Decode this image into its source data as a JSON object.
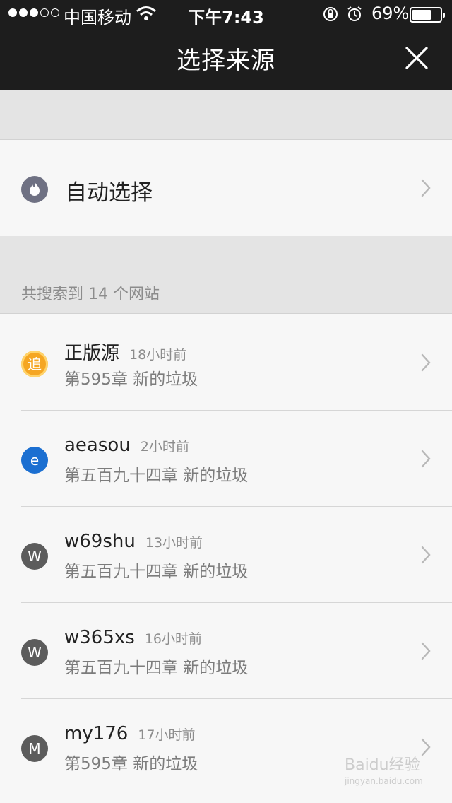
{
  "status_bar": {
    "carrier": "中国移动",
    "time": "下午7:43",
    "battery_percent": "69%",
    "battery_level": 0.69
  },
  "nav": {
    "title": "选择来源",
    "close_icon": "close-icon"
  },
  "auto_select": {
    "label": "自动选择",
    "icon": "flame-icon"
  },
  "result_count": "共搜索到 14 个网站",
  "sources": [
    {
      "name": "正版源",
      "time": "18小时前",
      "chapter": "第595章 新的垃圾",
      "icon_text": "追",
      "icon_color": "#f5a623"
    },
    {
      "name": "aeasou",
      "time": "2小时前",
      "chapter": "第五百九十四章 新的垃圾",
      "icon_text": "e",
      "icon_color": "#1b6fd1"
    },
    {
      "name": "w69shu",
      "time": "13小时前",
      "chapter": "第五百九十四章 新的垃圾",
      "icon_text": "W",
      "icon_color": "#5c5c5c"
    },
    {
      "name": "w365xs",
      "time": "16小时前",
      "chapter": "第五百九十四章 新的垃圾",
      "icon_text": "W",
      "icon_color": "#5c5c5c"
    },
    {
      "name": "my176",
      "time": "17小时前",
      "chapter": "第595章 新的垃圾",
      "icon_text": "M",
      "icon_color": "#5c5c5c"
    }
  ],
  "watermark": {
    "text": "Baidu经验",
    "sub": "jingyan.baidu.com"
  },
  "colors": {
    "topbar": "#1d1d1d",
    "background": "#f7f7f7",
    "band": "#e4e4e4"
  }
}
